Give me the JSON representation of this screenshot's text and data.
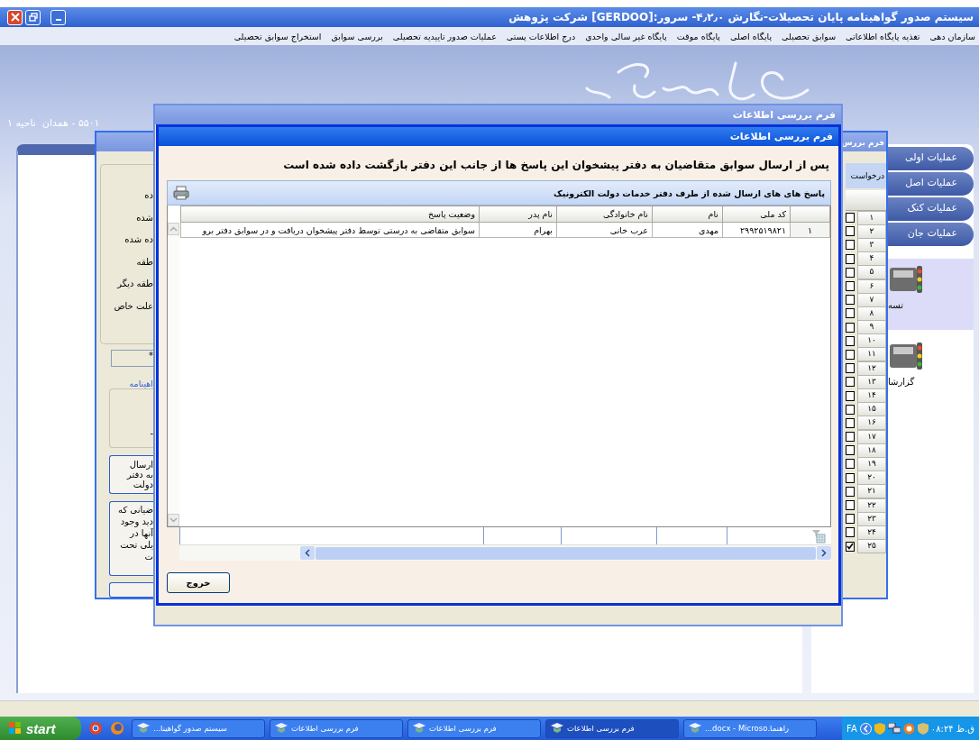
{
  "window": {
    "title": "سیستم صدور گواهینامه پایان تحصیلات-نگارش ۴٫۲٫۰- سرور:[GERDOO] شرکت پژوهش"
  },
  "menu": [
    "سازمان دهی",
    "تغذیه پایگاه اطلاعاتی",
    "سوابق تحصیلی",
    "پایگاه اصلی",
    "پایگاه موقت",
    "پایگاه غیر سالی واحدی",
    "درج اطلاعات پستی",
    "عملیات صدور تاییدیه تحصیلی",
    "بررسی سوابق",
    "استخراج سوابق تحصیلی"
  ],
  "region_label": "۵۵۰۱ - همدان  ناحیه ۱",
  "side_tabs": [
    "عملیات اولی",
    "عملیات اصل",
    "عملیات کنک",
    "عملیات جان"
  ],
  "side_shortcuts": [
    {
      "label": "تسه",
      "selected": true
    },
    {
      "label": "گزارشا",
      "selected": false
    }
  ],
  "background_form": {
    "title": "فرم بررس",
    "field_labels": [
      "ده",
      "شده",
      "ده شده",
      "طقه",
      "طقه دیگر",
      "علت خاص"
    ],
    "field_value": "*",
    "group_title": "اهینامه",
    "group_value": "-",
    "send_button": [
      "ارسال",
      "به دفتر",
      "دولت"
    ],
    "note_lines": [
      "ضیانی که",
      "دید وجود",
      "آنها در",
      "یلی تحت",
      "ت"
    ],
    "request_header": "درخواست",
    "rows": [
      {
        "number": "۱",
        "checked": false
      },
      {
        "number": "۲",
        "checked": false
      },
      {
        "number": "۳",
        "checked": false
      },
      {
        "number": "۴",
        "checked": false
      },
      {
        "number": "۵",
        "checked": false
      },
      {
        "number": "۶",
        "checked": false
      },
      {
        "number": "۷",
        "checked": false
      },
      {
        "number": "۸",
        "checked": false
      },
      {
        "number": "۹",
        "checked": false
      },
      {
        "number": "۱۰",
        "checked": false
      },
      {
        "number": "۱۱",
        "checked": false
      },
      {
        "number": "۱۲",
        "checked": false
      },
      {
        "number": "۱۳",
        "checked": false
      },
      {
        "number": "۱۴",
        "checked": false
      },
      {
        "number": "۱۵",
        "checked": false
      },
      {
        "number": "۱۶",
        "checked": false
      },
      {
        "number": "۱۷",
        "checked": false
      },
      {
        "number": "۱۸",
        "checked": false
      },
      {
        "number": "۱۹",
        "checked": false
      },
      {
        "number": "۲۰",
        "checked": false
      },
      {
        "number": "۲۱",
        "checked": false
      },
      {
        "number": "۲۲",
        "checked": false
      },
      {
        "number": "۲۳",
        "checked": false
      },
      {
        "number": "۲۴",
        "checked": false
      },
      {
        "number": "۲۵",
        "checked": true
      }
    ]
  },
  "middle_form": {
    "title": "فرم بررسی اطلاعات"
  },
  "dialog": {
    "title": "فرم بررسی اطلاعات",
    "message": "پس از ارسال سوابق متقاضیان به دفتر پیشخوان این پاسخ ها از جانب این دفتر بازگشت داده شده است",
    "group_title": "پاسخ های های ارسال شده از طرف دفتر خدمات دولت الکترونیک",
    "columns": [
      "کد ملی",
      "نام",
      "نام خانوادگی",
      "نام پدر",
      "وضعیت پاسخ"
    ],
    "rows": [
      {
        "index": "۱",
        "cells": [
          "۲۹۹۲۵۱۹۸۲۱",
          "مهدی",
          "عرب خانی",
          "بهرام",
          "سوابق متقاضی به درستی توسط دفتر پیشخوان دریافت و در سوابق دفتر برو"
        ]
      }
    ],
    "exit_button": "خروج"
  },
  "taskbar": {
    "start": "start",
    "tasks": [
      {
        "label": "راهنما.docx - Microso...",
        "selected": false
      },
      {
        "label": "فرم بررسی اطلاعات",
        "selected": true
      },
      {
        "label": "فرم بررسی اطلاعات",
        "selected": false
      },
      {
        "label": "فرم بررسی اطلاعات",
        "selected": false
      },
      {
        "label": "سیستم صدور گواهینا...",
        "selected": false
      }
    ],
    "language": "FA",
    "clock": "ق.ظ ۰۸:۲۴"
  }
}
